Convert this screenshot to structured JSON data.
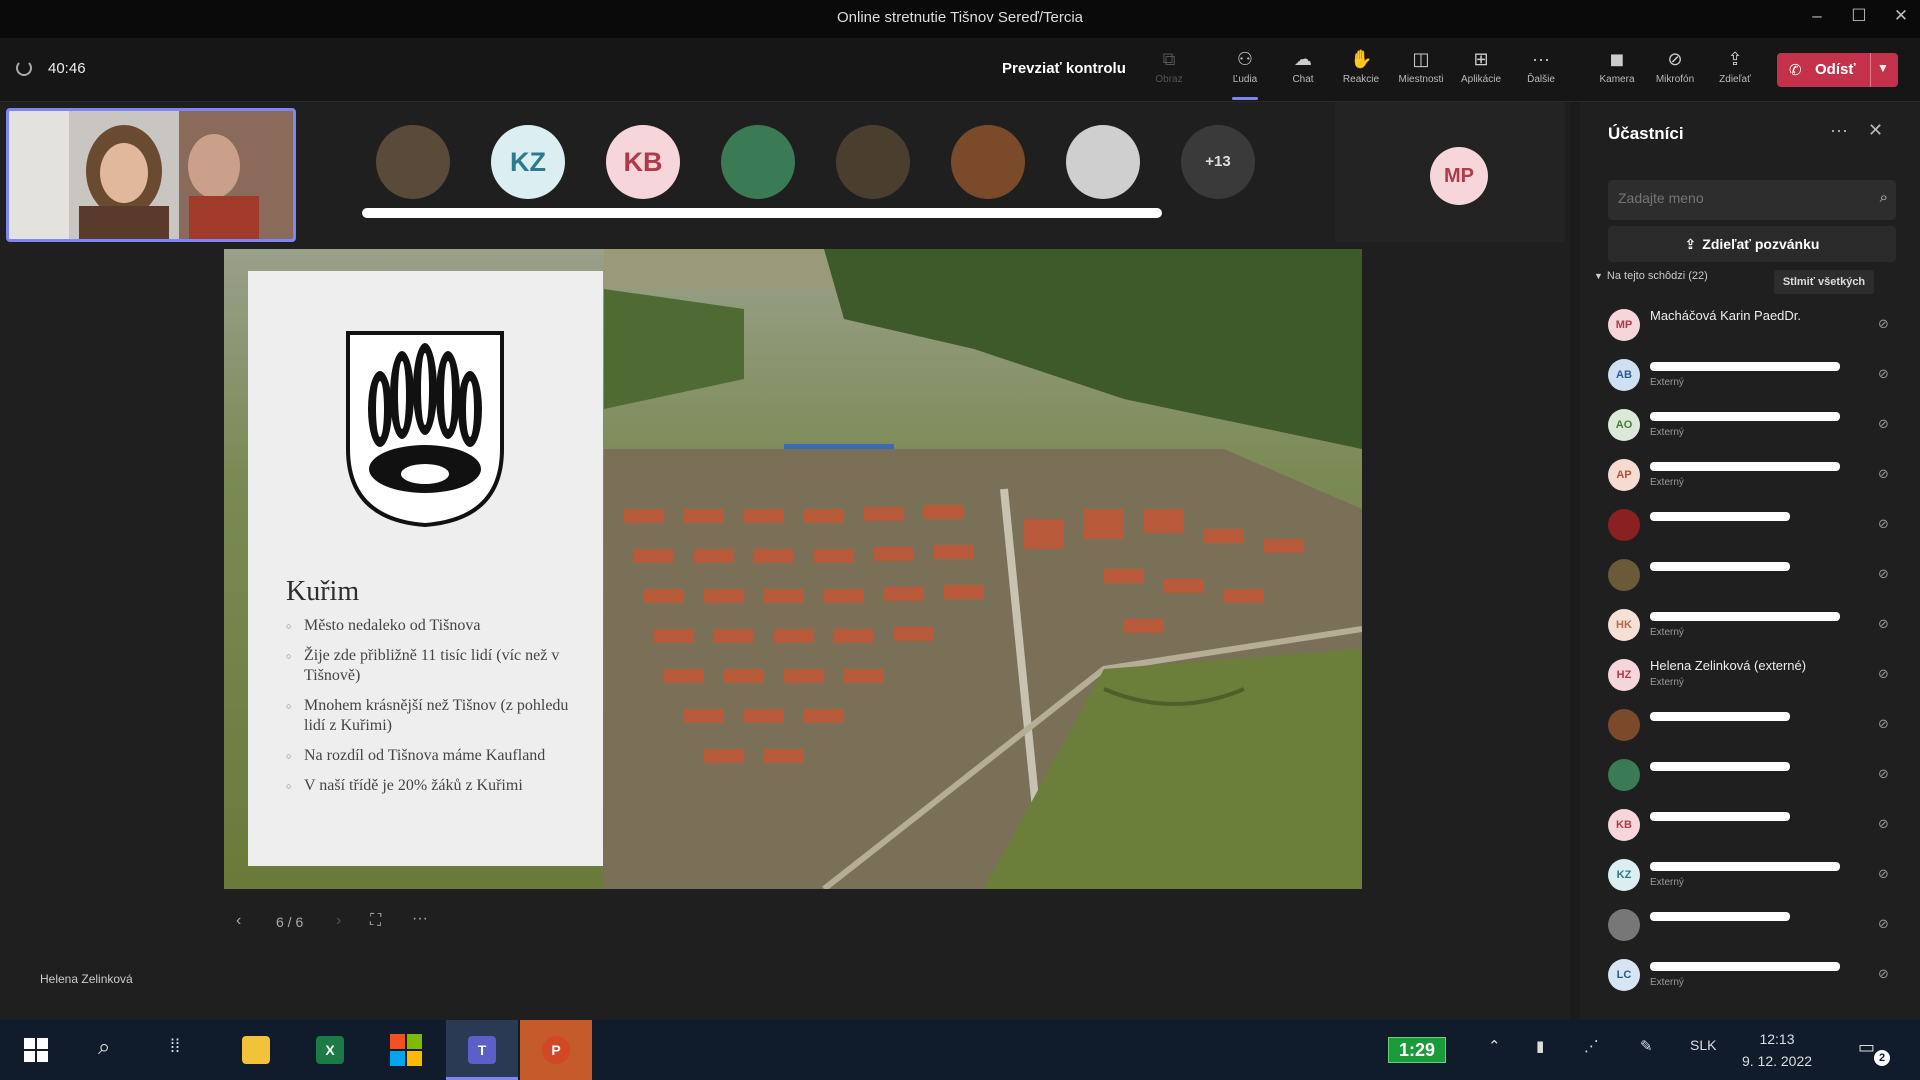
{
  "window": {
    "title": "Online stretnutie Tišnov  Sereď/Tercia"
  },
  "meeting": {
    "elapsed": "40:46",
    "take_control": "Prevziať kontrolu",
    "toolbar": [
      {
        "id": "close",
        "label": "Obraz",
        "icon": "cast-icon",
        "disabled": true
      },
      {
        "id": "people",
        "label": "Ľudia",
        "icon": "people-icon",
        "active": true
      },
      {
        "id": "chat",
        "label": "Chat",
        "icon": "chat-icon"
      },
      {
        "id": "reactions",
        "label": "Reakcie",
        "icon": "hand-icon"
      },
      {
        "id": "rooms",
        "label": "Miestnosti",
        "icon": "rooms-icon"
      },
      {
        "id": "apps",
        "label": "Aplikácie",
        "icon": "apps-icon"
      },
      {
        "id": "more",
        "label": "Ďalšie",
        "icon": "more-icon"
      },
      {
        "id": "camera",
        "label": "Kamera",
        "icon": "camera-off-icon"
      },
      {
        "id": "mic",
        "label": "Mikrofón",
        "icon": "mic-off-icon"
      },
      {
        "id": "share",
        "label": "Zdieľať",
        "icon": "share-icon"
      }
    ],
    "leave_label": "Odísť"
  },
  "gallery": {
    "avatars": [
      {
        "initials": "",
        "color": "#5a4a3a"
      },
      {
        "initials": "KZ",
        "color": "#dbeff3",
        "fg": "#2d7a8c"
      },
      {
        "initials": "KB",
        "color": "#f6d6da",
        "fg": "#b03a4a"
      },
      {
        "initials": "",
        "color": "#3a7a55"
      },
      {
        "initials": "",
        "color": "#4a3f2f"
      },
      {
        "initials": "",
        "color": "#7a4a2a"
      },
      {
        "initials": "",
        "color": "#cfcfcf"
      },
      {
        "initials": "+13",
        "color": "#3a3a3a",
        "fg": "#ddd"
      }
    ],
    "mp_initials": "MP"
  },
  "slide": {
    "heading": "Kuřim",
    "bullets": [
      "Město nedaleko od Tišnova",
      "Žije zde přibližně 11 tisíc lidí (víc než v Tišnově)",
      "Mnohem krásnější než Tišnov (z pohledu lidí z Kuřimi)",
      "Na rozdíl od Tišnova máme Kaufland",
      "V naší třídě je 20% žáků z Kuřimi"
    ],
    "page": "6 / 6",
    "presenter": "Helena Zelinková"
  },
  "panel": {
    "title": "Účastníci",
    "search_placeholder": "Zadajte meno",
    "share_invite": "Zdieľať pozvánku",
    "section": "Na tejto schôdzi (22)",
    "mute_all": "Stlmiť všetkých",
    "participants": [
      {
        "initials": "MP",
        "color": "#f6d6da",
        "fg": "#b03a4a",
        "name": "Macháčová Karin PaedDr.",
        "sub": ""
      },
      {
        "initials": "AB",
        "color": "#cfe0f3",
        "fg": "#2b5c94",
        "name": "",
        "sub": "Externý"
      },
      {
        "initials": "AO",
        "color": "#dce9d8",
        "fg": "#4a7a3a",
        "name": "",
        "sub": "Externý"
      },
      {
        "initials": "AP",
        "color": "#f6dbd1",
        "fg": "#b0503a",
        "name": "",
        "sub": "Externý"
      },
      {
        "initials": "",
        "color": "#8a2020",
        "name": "",
        "sub": ""
      },
      {
        "initials": "",
        "color": "#6a5a3a",
        "name": "",
        "sub": ""
      },
      {
        "initials": "HK",
        "color": "#f6e0d6",
        "fg": "#b06a4a",
        "name": "",
        "sub": "Externý"
      },
      {
        "initials": "HZ",
        "color": "#f6d6da",
        "fg": "#b03a4a",
        "name": "Helena Zelinková (externé)",
        "sub": "Externý"
      },
      {
        "initials": "",
        "color": "#7a4a2a",
        "name": "",
        "sub": ""
      },
      {
        "initials": "",
        "color": "#3a7a55",
        "name": "",
        "sub": ""
      },
      {
        "initials": "KB",
        "color": "#f6d6da",
        "fg": "#b03a4a",
        "name": "",
        "sub": ""
      },
      {
        "initials": "KZ",
        "color": "#dbeff3",
        "fg": "#2d7a8c",
        "name": "",
        "sub": "Externý"
      },
      {
        "initials": "",
        "color": "#777",
        "name": "",
        "sub": ""
      },
      {
        "initials": "LC",
        "color": "#d6e4f3",
        "fg": "#2b5c94",
        "name": "",
        "sub": "Externý"
      }
    ]
  },
  "taskbar": {
    "badge": "1:29",
    "lang": "SLK",
    "time": "12:13",
    "date": "9. 12. 2022",
    "notif": "2"
  }
}
